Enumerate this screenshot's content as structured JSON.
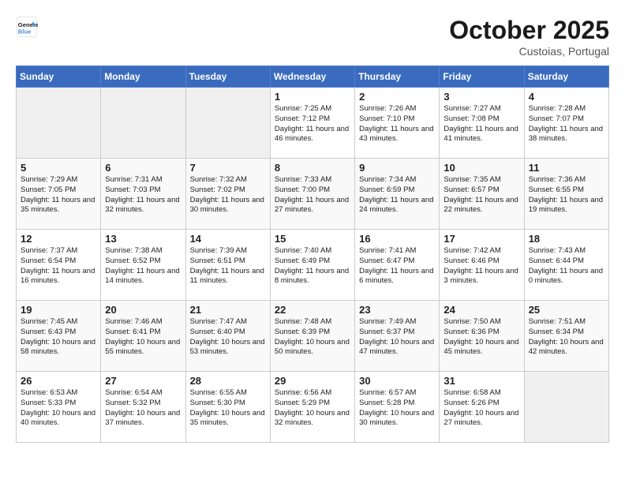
{
  "header": {
    "logo_text_general": "General",
    "logo_text_blue": "Blue",
    "month_title": "October 2025",
    "location": "Custoias, Portugal"
  },
  "weekdays": [
    "Sunday",
    "Monday",
    "Tuesday",
    "Wednesday",
    "Thursday",
    "Friday",
    "Saturday"
  ],
  "weeks": [
    [
      {
        "day": "",
        "sunrise": "",
        "sunset": "",
        "daylight": "",
        "empty": true
      },
      {
        "day": "",
        "sunrise": "",
        "sunset": "",
        "daylight": "",
        "empty": true
      },
      {
        "day": "",
        "sunrise": "",
        "sunset": "",
        "daylight": "",
        "empty": true
      },
      {
        "day": "1",
        "sunrise": "Sunrise: 7:25 AM",
        "sunset": "Sunset: 7:12 PM",
        "daylight": "Daylight: 11 hours and 46 minutes.",
        "empty": false
      },
      {
        "day": "2",
        "sunrise": "Sunrise: 7:26 AM",
        "sunset": "Sunset: 7:10 PM",
        "daylight": "Daylight: 11 hours and 43 minutes.",
        "empty": false
      },
      {
        "day": "3",
        "sunrise": "Sunrise: 7:27 AM",
        "sunset": "Sunset: 7:08 PM",
        "daylight": "Daylight: 11 hours and 41 minutes.",
        "empty": false
      },
      {
        "day": "4",
        "sunrise": "Sunrise: 7:28 AM",
        "sunset": "Sunset: 7:07 PM",
        "daylight": "Daylight: 11 hours and 38 minutes.",
        "empty": false
      }
    ],
    [
      {
        "day": "5",
        "sunrise": "Sunrise: 7:29 AM",
        "sunset": "Sunset: 7:05 PM",
        "daylight": "Daylight: 11 hours and 35 minutes.",
        "empty": false
      },
      {
        "day": "6",
        "sunrise": "Sunrise: 7:31 AM",
        "sunset": "Sunset: 7:03 PM",
        "daylight": "Daylight: 11 hours and 32 minutes.",
        "empty": false
      },
      {
        "day": "7",
        "sunrise": "Sunrise: 7:32 AM",
        "sunset": "Sunset: 7:02 PM",
        "daylight": "Daylight: 11 hours and 30 minutes.",
        "empty": false
      },
      {
        "day": "8",
        "sunrise": "Sunrise: 7:33 AM",
        "sunset": "Sunset: 7:00 PM",
        "daylight": "Daylight: 11 hours and 27 minutes.",
        "empty": false
      },
      {
        "day": "9",
        "sunrise": "Sunrise: 7:34 AM",
        "sunset": "Sunset: 6:59 PM",
        "daylight": "Daylight: 11 hours and 24 minutes.",
        "empty": false
      },
      {
        "day": "10",
        "sunrise": "Sunrise: 7:35 AM",
        "sunset": "Sunset: 6:57 PM",
        "daylight": "Daylight: 11 hours and 22 minutes.",
        "empty": false
      },
      {
        "day": "11",
        "sunrise": "Sunrise: 7:36 AM",
        "sunset": "Sunset: 6:55 PM",
        "daylight": "Daylight: 11 hours and 19 minutes.",
        "empty": false
      }
    ],
    [
      {
        "day": "12",
        "sunrise": "Sunrise: 7:37 AM",
        "sunset": "Sunset: 6:54 PM",
        "daylight": "Daylight: 11 hours and 16 minutes.",
        "empty": false
      },
      {
        "day": "13",
        "sunrise": "Sunrise: 7:38 AM",
        "sunset": "Sunset: 6:52 PM",
        "daylight": "Daylight: 11 hours and 14 minutes.",
        "empty": false
      },
      {
        "day": "14",
        "sunrise": "Sunrise: 7:39 AM",
        "sunset": "Sunset: 6:51 PM",
        "daylight": "Daylight: 11 hours and 11 minutes.",
        "empty": false
      },
      {
        "day": "15",
        "sunrise": "Sunrise: 7:40 AM",
        "sunset": "Sunset: 6:49 PM",
        "daylight": "Daylight: 11 hours and 8 minutes.",
        "empty": false
      },
      {
        "day": "16",
        "sunrise": "Sunrise: 7:41 AM",
        "sunset": "Sunset: 6:47 PM",
        "daylight": "Daylight: 11 hours and 6 minutes.",
        "empty": false
      },
      {
        "day": "17",
        "sunrise": "Sunrise: 7:42 AM",
        "sunset": "Sunset: 6:46 PM",
        "daylight": "Daylight: 11 hours and 3 minutes.",
        "empty": false
      },
      {
        "day": "18",
        "sunrise": "Sunrise: 7:43 AM",
        "sunset": "Sunset: 6:44 PM",
        "daylight": "Daylight: 11 hours and 0 minutes.",
        "empty": false
      }
    ],
    [
      {
        "day": "19",
        "sunrise": "Sunrise: 7:45 AM",
        "sunset": "Sunset: 6:43 PM",
        "daylight": "Daylight: 10 hours and 58 minutes.",
        "empty": false
      },
      {
        "day": "20",
        "sunrise": "Sunrise: 7:46 AM",
        "sunset": "Sunset: 6:41 PM",
        "daylight": "Daylight: 10 hours and 55 minutes.",
        "empty": false
      },
      {
        "day": "21",
        "sunrise": "Sunrise: 7:47 AM",
        "sunset": "Sunset: 6:40 PM",
        "daylight": "Daylight: 10 hours and 53 minutes.",
        "empty": false
      },
      {
        "day": "22",
        "sunrise": "Sunrise: 7:48 AM",
        "sunset": "Sunset: 6:39 PM",
        "daylight": "Daylight: 10 hours and 50 minutes.",
        "empty": false
      },
      {
        "day": "23",
        "sunrise": "Sunrise: 7:49 AM",
        "sunset": "Sunset: 6:37 PM",
        "daylight": "Daylight: 10 hours and 47 minutes.",
        "empty": false
      },
      {
        "day": "24",
        "sunrise": "Sunrise: 7:50 AM",
        "sunset": "Sunset: 6:36 PM",
        "daylight": "Daylight: 10 hours and 45 minutes.",
        "empty": false
      },
      {
        "day": "25",
        "sunrise": "Sunrise: 7:51 AM",
        "sunset": "Sunset: 6:34 PM",
        "daylight": "Daylight: 10 hours and 42 minutes.",
        "empty": false
      }
    ],
    [
      {
        "day": "26",
        "sunrise": "Sunrise: 6:53 AM",
        "sunset": "Sunset: 5:33 PM",
        "daylight": "Daylight: 10 hours and 40 minutes.",
        "empty": false
      },
      {
        "day": "27",
        "sunrise": "Sunrise: 6:54 AM",
        "sunset": "Sunset: 5:32 PM",
        "daylight": "Daylight: 10 hours and 37 minutes.",
        "empty": false
      },
      {
        "day": "28",
        "sunrise": "Sunrise: 6:55 AM",
        "sunset": "Sunset: 5:30 PM",
        "daylight": "Daylight: 10 hours and 35 minutes.",
        "empty": false
      },
      {
        "day": "29",
        "sunrise": "Sunrise: 6:56 AM",
        "sunset": "Sunset: 5:29 PM",
        "daylight": "Daylight: 10 hours and 32 minutes.",
        "empty": false
      },
      {
        "day": "30",
        "sunrise": "Sunrise: 6:57 AM",
        "sunset": "Sunset: 5:28 PM",
        "daylight": "Daylight: 10 hours and 30 minutes.",
        "empty": false
      },
      {
        "day": "31",
        "sunrise": "Sunrise: 6:58 AM",
        "sunset": "Sunset: 5:26 PM",
        "daylight": "Daylight: 10 hours and 27 minutes.",
        "empty": false
      },
      {
        "day": "",
        "sunrise": "",
        "sunset": "",
        "daylight": "",
        "empty": true
      }
    ]
  ]
}
